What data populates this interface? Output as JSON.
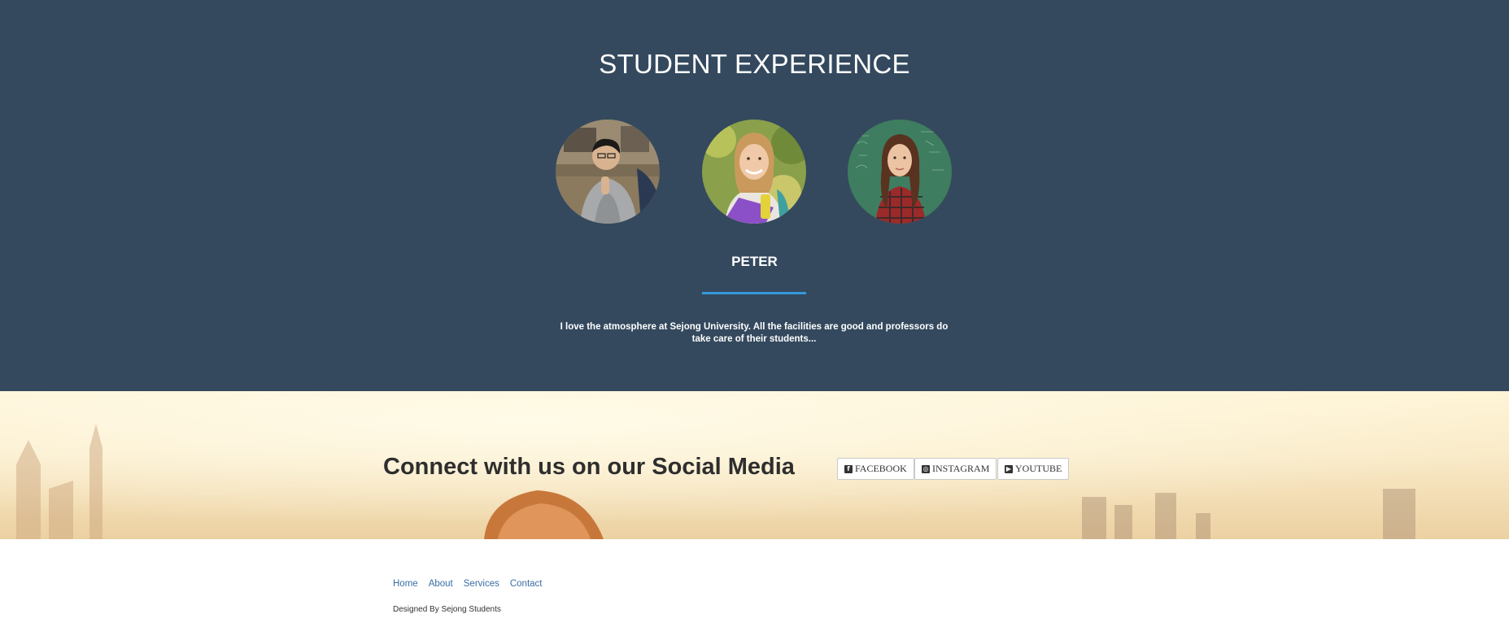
{
  "experience": {
    "title": "STUDENT EXPERIENCE",
    "background": "#34495e",
    "students": [
      {
        "photo": "male-student-photo"
      },
      {
        "photo": "female-student-photo-smiling"
      },
      {
        "photo": "female-student-photo-chalkboard"
      }
    ],
    "active_name": "PETER",
    "accent_color": "#3498db",
    "quote": "I love the atmosphere at Sejong University. All the facilities are good and professors do take care of their students..."
  },
  "social": {
    "heading": "Connect with us on our Social Media",
    "buttons": [
      {
        "label": "FACEBOOK",
        "icon": "facebook-icon"
      },
      {
        "label": "INSTAGRAM",
        "icon": "instagram-icon"
      },
      {
        "label": "YOUTUBE",
        "icon": "youtube-icon"
      }
    ]
  },
  "footer": {
    "nav": [
      "Home",
      "About",
      "Services",
      "Contact"
    ],
    "credit": "Designed By Sejong Students",
    "link_color": "#3a6ea5"
  }
}
